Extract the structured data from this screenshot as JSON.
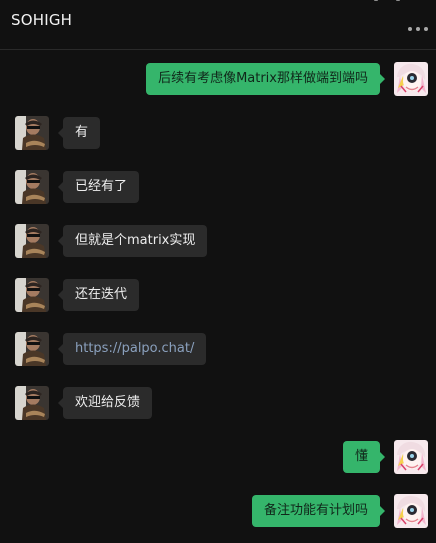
{
  "window": {
    "title": "SOHIGH"
  },
  "colors": {
    "background": "#111111",
    "incoming_bubble": "#2b2b2b",
    "outgoing_bubble": "#35b56b",
    "link_text": "#8aa0bd"
  },
  "messages": [
    {
      "side": "right",
      "sender": "self",
      "text": "后续有考虑像Matrix那样做端到端吗"
    },
    {
      "side": "left",
      "sender": "contact",
      "text": "有"
    },
    {
      "side": "left",
      "sender": "contact",
      "text": "已经有了"
    },
    {
      "side": "left",
      "sender": "contact",
      "text": "但就是个matrix实现"
    },
    {
      "side": "left",
      "sender": "contact",
      "text": "还在迭代"
    },
    {
      "side": "left",
      "sender": "contact",
      "text": "https://palpo.chat/",
      "is_link": true
    },
    {
      "side": "left",
      "sender": "contact",
      "text": "欢迎给反馈"
    },
    {
      "side": "right",
      "sender": "self",
      "text": "懂"
    },
    {
      "side": "right",
      "sender": "self",
      "text": "备注功能有计划吗"
    }
  ],
  "icons": {
    "more": "more-horizontal-icon",
    "contact_avatar": "contact-avatar",
    "self_avatar": "self-avatar"
  }
}
